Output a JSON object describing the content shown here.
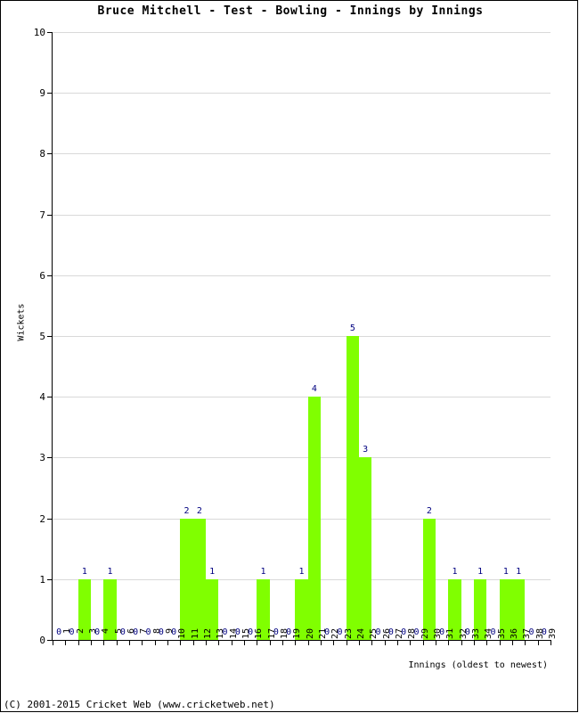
{
  "chart_data": {
    "type": "bar",
    "title": "Bruce Mitchell - Test - Bowling - Innings by Innings",
    "xlabel": "Innings (oldest to newest)",
    "ylabel": "Wickets",
    "ylim": [
      0,
      10
    ],
    "yticks": [
      0,
      1,
      2,
      3,
      4,
      5,
      6,
      7,
      8,
      9,
      10
    ],
    "grid": true,
    "legend": null,
    "bar_color": "#80ff00",
    "label_color": "#000080",
    "categories": [
      "1",
      "2",
      "3",
      "4",
      "5",
      "6",
      "7",
      "8",
      "9",
      "10",
      "11",
      "12",
      "13",
      "14",
      "15",
      "16",
      "17",
      "18",
      "19",
      "20",
      "21",
      "22",
      "23",
      "24",
      "25",
      "26",
      "27",
      "28",
      "29",
      "30",
      "31",
      "32",
      "33",
      "34",
      "35",
      "36",
      "37",
      "38",
      "39"
    ],
    "values": [
      0,
      0,
      1,
      0,
      1,
      0,
      0,
      0,
      0,
      0,
      2,
      2,
      1,
      0,
      0,
      0,
      1,
      0,
      0,
      1,
      4,
      0,
      0,
      5,
      3,
      0,
      0,
      0,
      0,
      2,
      0,
      1,
      0,
      1,
      0,
      1,
      1,
      0,
      0
    ],
    "data_labels": [
      "0",
      "0",
      "1",
      "0",
      "1",
      "0",
      "0",
      "0",
      "0",
      "0",
      "2",
      "2",
      "1",
      "0",
      "0",
      "0",
      "1",
      "0",
      "0",
      "1",
      "4",
      "0",
      "0",
      "5",
      "3",
      "0",
      "0",
      "0",
      "0",
      "2",
      "0",
      "1",
      "0",
      "1",
      "0",
      "1",
      "1",
      "0",
      "0"
    ]
  },
  "footer": {
    "copyright": "(C) 2001-2015 Cricket Web (www.cricketweb.net)"
  }
}
